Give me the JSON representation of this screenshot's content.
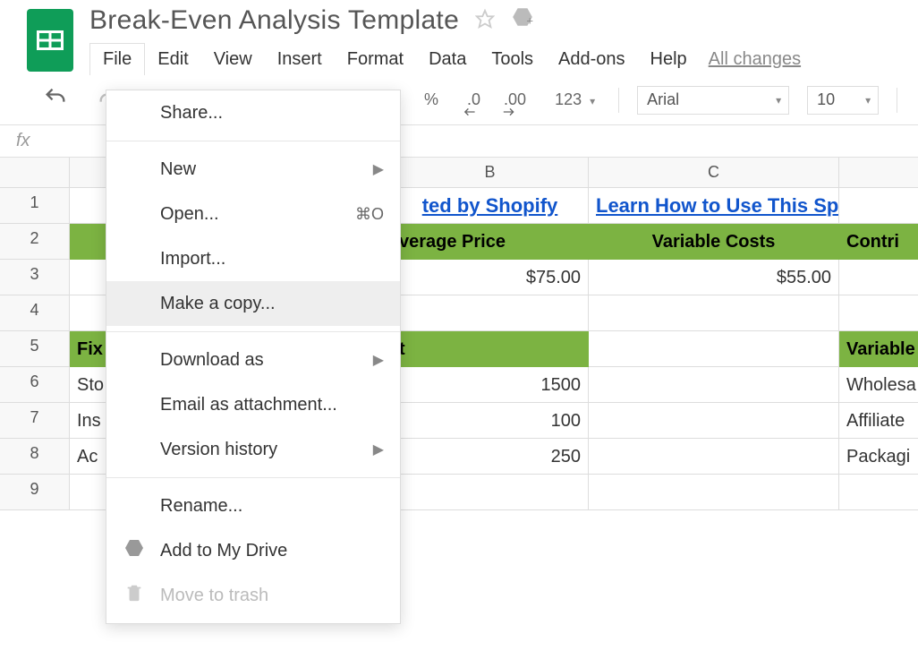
{
  "doc": {
    "title": "Break-Even Analysis Template"
  },
  "menubar": {
    "file": "File",
    "edit": "Edit",
    "view": "View",
    "insert": "Insert",
    "format": "Format",
    "data": "Data",
    "tools": "Tools",
    "addons": "Add-ons",
    "help": "Help",
    "all_changes": "All changes"
  },
  "toolbar": {
    "percent": "%",
    "dec_less": ".0",
    "dec_more": ".00",
    "num_format": "123",
    "font": "Arial",
    "font_size": "10"
  },
  "fx": {
    "label": "fx"
  },
  "dropdown": {
    "share": "Share...",
    "new": "New",
    "open": "Open...",
    "open_shortcut": "⌘O",
    "import": "Import...",
    "make_copy": "Make a copy...",
    "download_as": "Download as",
    "email_attachment": "Email as attachment...",
    "version_history": "Version history",
    "rename": "Rename...",
    "add_to_drive": "Add to My Drive",
    "move_to_trash": "Move to trash"
  },
  "columns": {
    "B": "B",
    "C": "C"
  },
  "rows": {
    "r1": "1",
    "r2": "2",
    "r3": "3",
    "r4": "4",
    "r5": "5",
    "r6": "6",
    "r7": "7",
    "r8": "8",
    "r9": "9"
  },
  "cells": {
    "A1_link": "Created by Shopify",
    "B1_fragment": "ted by Shopify",
    "C1_link": "Learn How to Use This Sp",
    "B2_fragment": "verage Price",
    "C2": "Variable Costs",
    "D2": "Contri",
    "B3": "$75.00",
    "C3": "$55.00",
    "A5": "Fix",
    "B5_fragment": "t",
    "D5": "Variable",
    "A6": "Sto",
    "B6": "1500",
    "D6": "Wholesa",
    "A7": "Ins",
    "B7": "100",
    "D7": "Affiliate",
    "A8": "Ac",
    "B8": "250",
    "D8": "Packagi"
  }
}
